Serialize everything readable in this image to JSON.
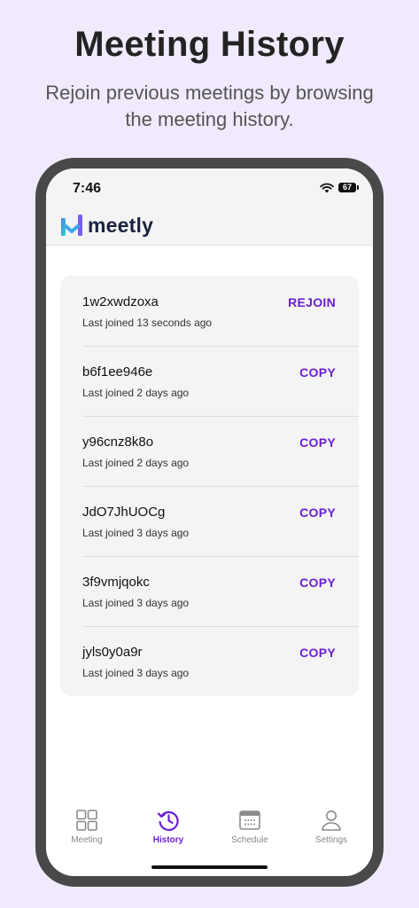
{
  "promo": {
    "title": "Meeting History",
    "subtitle": "Rejoin previous meetings by browsing the meeting history."
  },
  "status_bar": {
    "time": "7:46",
    "battery": "67"
  },
  "app": {
    "name": "meetly"
  },
  "history": [
    {
      "code": "1w2xwdzoxa",
      "last_joined": "Last joined 13 seconds ago",
      "action": "REJOIN"
    },
    {
      "code": "b6f1ee946e",
      "last_joined": "Last joined 2 days ago",
      "action": "COPY"
    },
    {
      "code": "y96cnz8k8o",
      "last_joined": "Last joined 2 days ago",
      "action": "COPY"
    },
    {
      "code": "JdO7JhUOCg",
      "last_joined": "Last joined 3 days ago",
      "action": "COPY"
    },
    {
      "code": "3f9vmjqokc",
      "last_joined": "Last joined 3 days ago",
      "action": "COPY"
    },
    {
      "code": "jyls0y0a9r",
      "last_joined": "Last joined 3 days ago",
      "action": "COPY"
    }
  ],
  "nav": {
    "meeting": "Meeting",
    "history": "History",
    "schedule": "Schedule",
    "settings": "Settings"
  },
  "colors": {
    "accent": "#6a1fd0",
    "background": "#f0eafc",
    "phone_frame": "#494949"
  },
  "icons": {
    "meeting": "grid-icon",
    "history": "history-clock-icon",
    "schedule": "calendar-icon",
    "settings": "person-icon"
  }
}
